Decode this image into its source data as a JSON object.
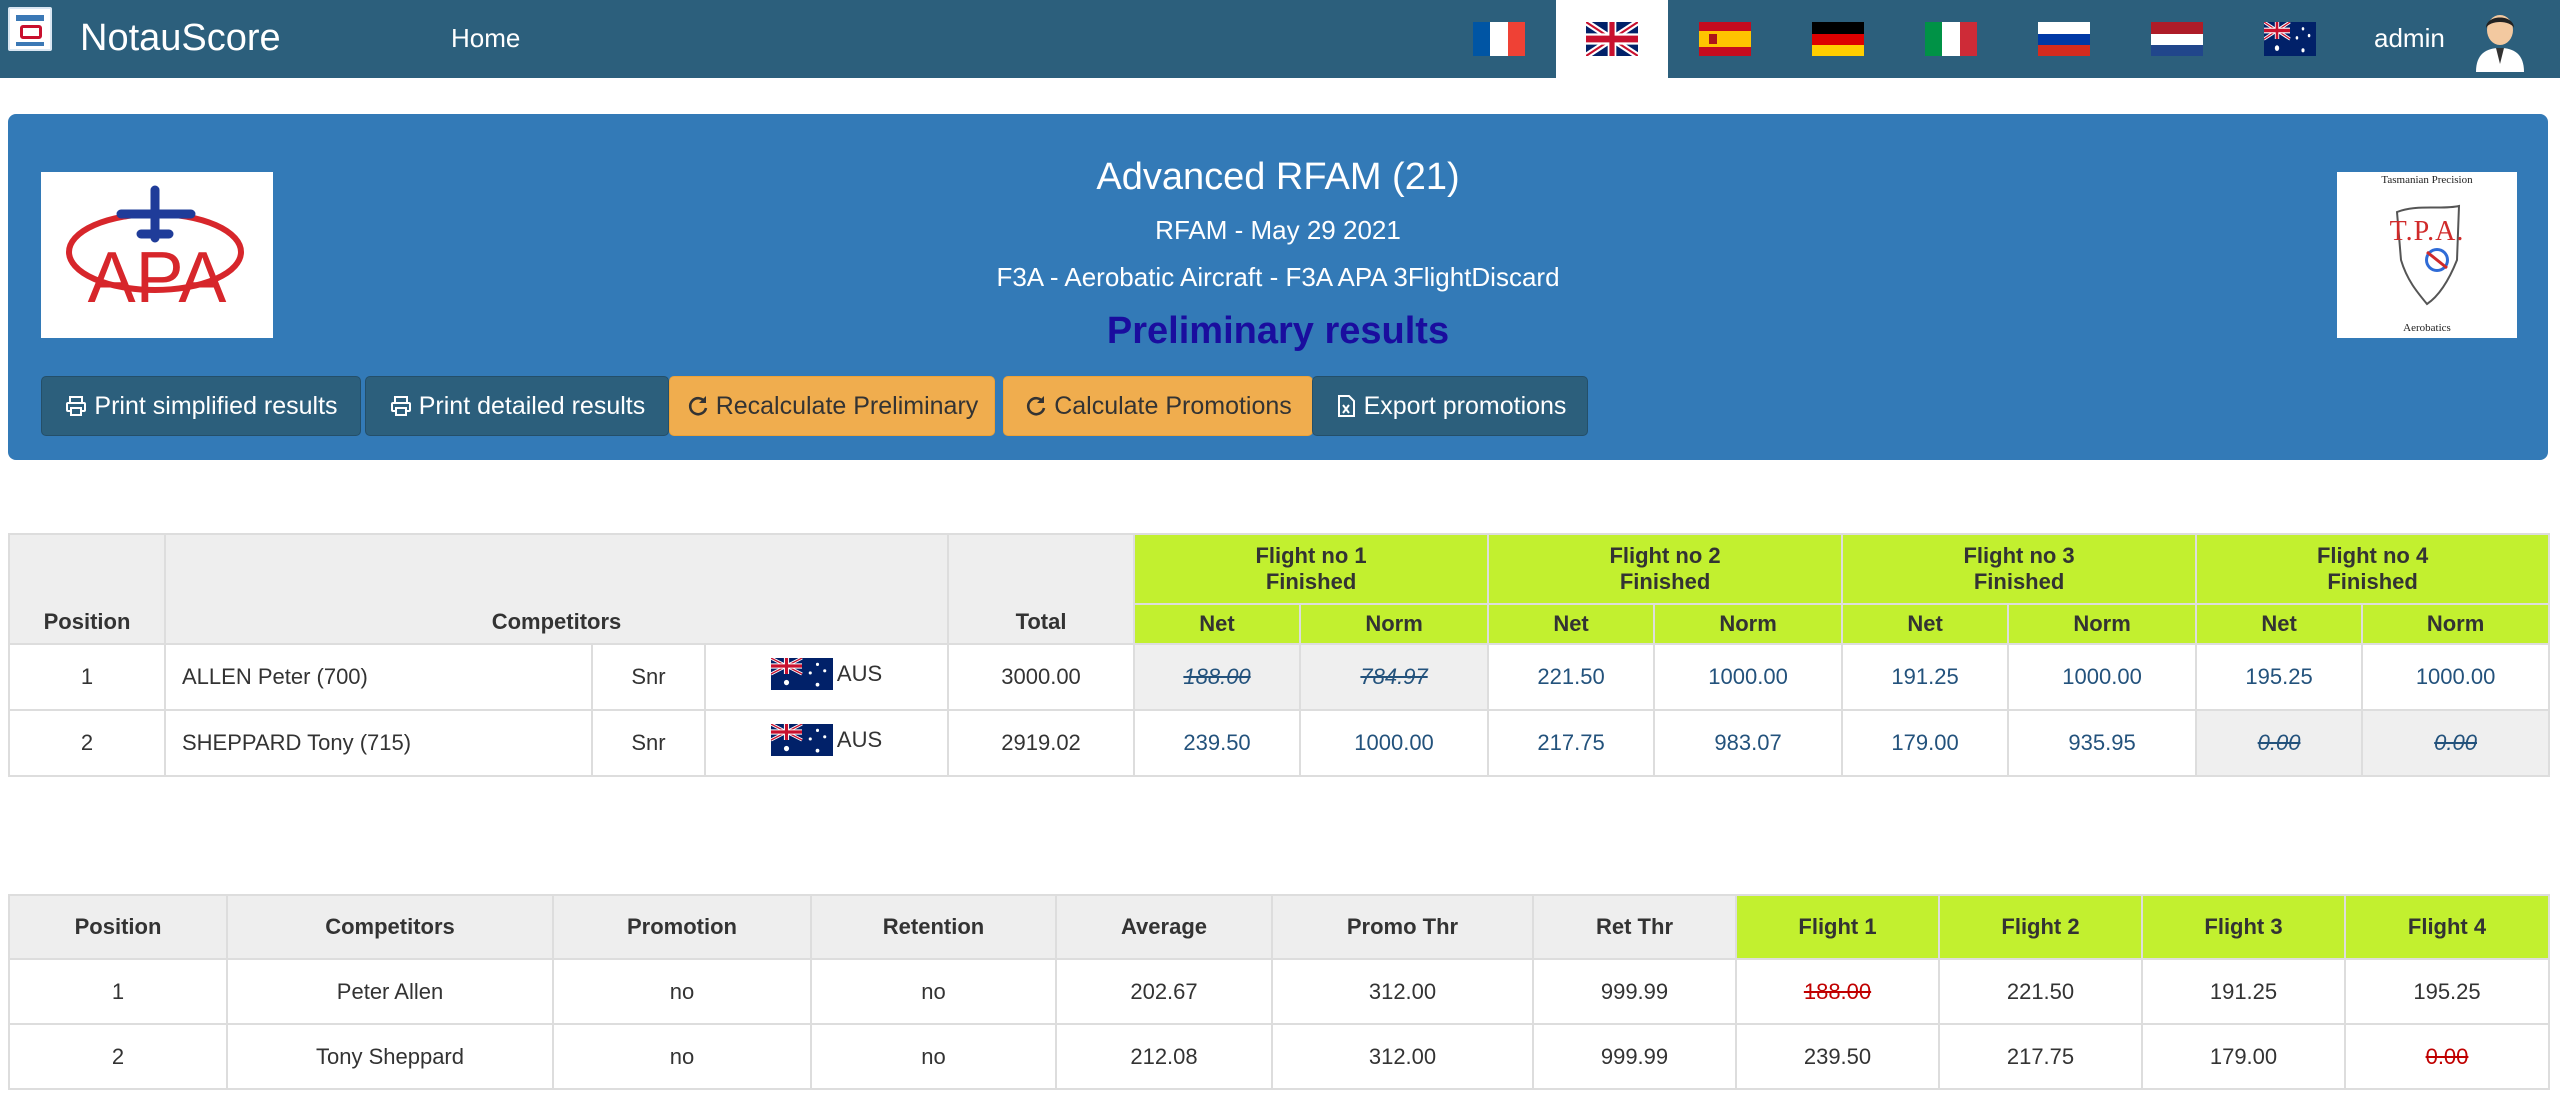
{
  "navbar": {
    "brand": "NotauScore",
    "home": "Home",
    "languages": [
      {
        "code": "fr",
        "icon": "flag-france-icon"
      },
      {
        "code": "en",
        "icon": "flag-uk-icon",
        "active": true
      },
      {
        "code": "es",
        "icon": "flag-spain-icon"
      },
      {
        "code": "de",
        "icon": "flag-germany-icon"
      },
      {
        "code": "it",
        "icon": "flag-italy-icon"
      },
      {
        "code": "ru",
        "icon": "flag-russia-icon"
      },
      {
        "code": "nl",
        "icon": "flag-netherlands-icon"
      },
      {
        "code": "au",
        "icon": "flag-australia-icon"
      }
    ],
    "user": "admin"
  },
  "header": {
    "title": "Advanced RFAM (21)",
    "subtitle": "RFAM - May 29 2021",
    "category": "F3A - Aerobatic Aircraft - F3A APA 3FlightDiscard",
    "status": "Preliminary results",
    "left_logo_text": "APA",
    "right_logo": {
      "top": "Tasmanian Precision",
      "middle": "T.P.A.",
      "bottom": "Aerobatics"
    },
    "buttons": {
      "print_simplified": "Print simplified results",
      "print_detailed": "Print detailed results",
      "recalculate": "Recalculate Preliminary",
      "promotions": "Calculate Promotions",
      "export": "Export promotions"
    }
  },
  "results": {
    "headers": {
      "position": "Position",
      "competitors": "Competitors",
      "total": "Total",
      "flights": [
        {
          "name": "Flight no 1",
          "status": "Finished"
        },
        {
          "name": "Flight no 2",
          "status": "Finished"
        },
        {
          "name": "Flight no 3",
          "status": "Finished"
        },
        {
          "name": "Flight no 4",
          "status": "Finished"
        }
      ],
      "net": "Net",
      "norm": "Norm"
    },
    "rows": [
      {
        "position": "1",
        "name": "ALLEN Peter (700)",
        "class": "Snr",
        "country": "AUS",
        "total": "3000.00",
        "flights": [
          {
            "net": "188.00",
            "norm": "784.97",
            "discarded": true
          },
          {
            "net": "221.50",
            "norm": "1000.00",
            "discarded": false
          },
          {
            "net": "191.25",
            "norm": "1000.00",
            "discarded": false
          },
          {
            "net": "195.25",
            "norm": "1000.00",
            "discarded": false
          }
        ]
      },
      {
        "position": "2",
        "name": "SHEPPARD Tony (715)",
        "class": "Snr",
        "country": "AUS",
        "total": "2919.02",
        "flights": [
          {
            "net": "239.50",
            "norm": "1000.00",
            "discarded": false
          },
          {
            "net": "217.75",
            "norm": "983.07",
            "discarded": false
          },
          {
            "net": "179.00",
            "norm": "935.95",
            "discarded": false
          },
          {
            "net": "0.00",
            "norm": "0.00",
            "discarded": true
          }
        ]
      }
    ]
  },
  "promotions": {
    "headers": [
      "Position",
      "Competitors",
      "Promotion",
      "Retention",
      "Average",
      "Promo Thr",
      "Ret Thr",
      "Flight 1",
      "Flight 2",
      "Flight 3",
      "Flight 4"
    ],
    "rows": [
      {
        "position": "1",
        "name": "Peter Allen",
        "promotion": "no",
        "retention": "no",
        "average": "202.67",
        "promo_thr": "312.00",
        "ret_thr": "999.99",
        "flights": [
          {
            "v": "188.00",
            "discarded": true
          },
          {
            "v": "221.50"
          },
          {
            "v": "191.25"
          },
          {
            "v": "195.25"
          }
        ]
      },
      {
        "position": "2",
        "name": "Tony Sheppard",
        "promotion": "no",
        "retention": "no",
        "average": "212.08",
        "promo_thr": "312.00",
        "ret_thr": "999.99",
        "flights": [
          {
            "v": "239.50"
          },
          {
            "v": "217.75"
          },
          {
            "v": "179.00"
          },
          {
            "v": "0.00",
            "discarded": true
          }
        ]
      }
    ]
  },
  "colors": {
    "navbar": "#2c5f7c",
    "panel": "#337ab7",
    "flight_header": "#c2f02f",
    "orange_button": "#f0ad4e",
    "preliminary_text": "#1a0d9e"
  }
}
